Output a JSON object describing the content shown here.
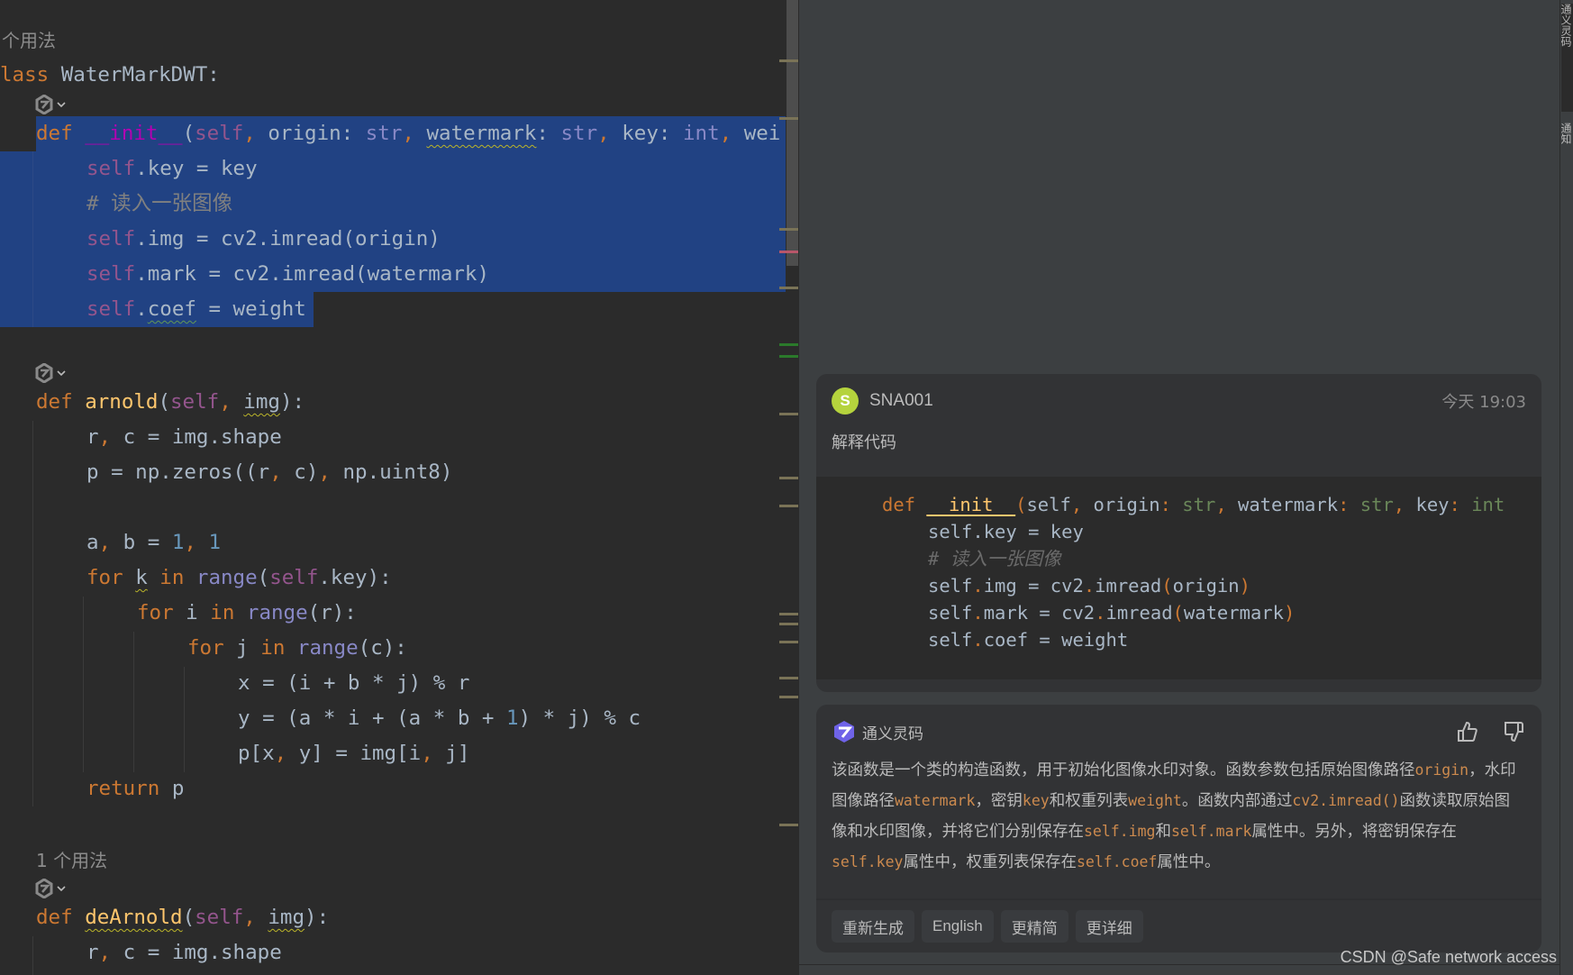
{
  "editor": {
    "usage_hint_top": "个用法",
    "usage_hint_bottom": "1 个用法",
    "class_kw": "lass",
    "class_name": "WaterMarkDWT",
    "init_sig": {
      "def": "def",
      "name": "__init__",
      "p_self": "self",
      "p_origin": "origin",
      "t1": "str",
      "p_watermark": "watermark",
      "t2": "str",
      "p_key": "key",
      "t3": "int",
      "p_weight_partial": "wei"
    },
    "init_body": {
      "l1_a": "self",
      "l1_b": ".key = key",
      "l2": "# 读入一张图像",
      "l3_a": "self",
      "l3_b": ".img = cv2.imread(origin)",
      "l4_a": "self",
      "l4_b": ".mark = cv2.imread(watermark)",
      "l5_a": "self",
      "l5_b": ".",
      "l5_c": "coef",
      "l5_d": " = weight"
    },
    "arnold": {
      "def": "def",
      "name": "arnold",
      "self": "self",
      "img": "img",
      "l1": "r",
      "l1b": " c = img.shape",
      "l2a": "p = np.zeros((r",
      "l2b": " c)",
      "l2c": " np.uint8)",
      "l3a": "a",
      "l3b": " b = ",
      "l3c": "1",
      "l3d": "1",
      "l4_for": "for",
      "l4_k": "k",
      "l4_in": "in",
      "l4_range": "range",
      "l4_self": "self",
      "l4_rest": ".key):",
      "l5_for": "for",
      "l5_i": " i ",
      "l5_in": "in",
      "l5_range": "range",
      "l5_rest": "(r):",
      "l6_for": "for",
      "l6_j": " j ",
      "l6_in": "in",
      "l6_range": "range",
      "l6_rest": "(c):",
      "l7": "x = (i + b * j) % r",
      "l8a": "y = (a * i + (a * b + ",
      "l8b": "1",
      "l8c": ") * j) % c",
      "l9a": "p[x",
      "l9b": " y] = img[i",
      "l9c": " j]",
      "l10_kw": "return",
      "l10_rest": " p"
    },
    "dearnold": {
      "def": "def",
      "name": "deArnold",
      "self": "self",
      "img": "img",
      "l1": "r",
      "l1b": " c = img.shape"
    }
  },
  "chat": {
    "user": {
      "avatar_letter": "S",
      "avatar_color": "#b5d33d",
      "name": "SNA001",
      "time": "今天 19:03",
      "message": "解释代码"
    },
    "code": {
      "l1_def": "def",
      "l1_name": "__init__",
      "l1_rest1": "self",
      "l1_origin": " origin",
      "l1_str1": "str",
      "l1_wm": " watermark",
      "l1_str2": "str",
      "l1_key": " key",
      "l1_int": "int",
      "l2": "self.key = key",
      "l3": "# 读入一张图像",
      "l4a": "self",
      "l4b": "img = cv2",
      "l4c": "imread",
      "l4d": "origin",
      "l5a": "self",
      "l5b": "mark = cv2",
      "l5c": "imread",
      "l5d": "watermark",
      "l6a": "self",
      "l6b": "coef = weight"
    },
    "assistant": {
      "name": "通义灵码",
      "text": [
        {
          "t": "该函数是一个类的构造函数，用于初始化图像水印对象。函数参数包括原始图像路径"
        },
        {
          "c": "origin"
        },
        {
          "t": "，水印图像路径"
        },
        {
          "c": "watermark"
        },
        {
          "t": "，密钥"
        },
        {
          "c": "key"
        },
        {
          "t": "和权重列表"
        },
        {
          "c": "weight"
        },
        {
          "t": "。函数内部通过"
        },
        {
          "c": "cv2.imread()"
        },
        {
          "t": "函数读取原始图像和水印图像，并将它们分别保存在"
        },
        {
          "c": "self.img"
        },
        {
          "t": "和"
        },
        {
          "c": "self.mark"
        },
        {
          "t": "属性中。另外，将密钥保存在"
        },
        {
          "c": "self.key"
        },
        {
          "t": "属性中，权重列表保存在"
        },
        {
          "c": "self.coef"
        },
        {
          "t": "属性中。"
        }
      ],
      "actions": [
        "重新生成",
        "English",
        "更精简",
        "更详细"
      ]
    }
  },
  "sidebar": {
    "tabs": [
      {
        "label": "通义灵码",
        "active": true
      },
      {
        "label": "通知",
        "active": false
      }
    ]
  },
  "watermark": "CSDN @Safe network access"
}
